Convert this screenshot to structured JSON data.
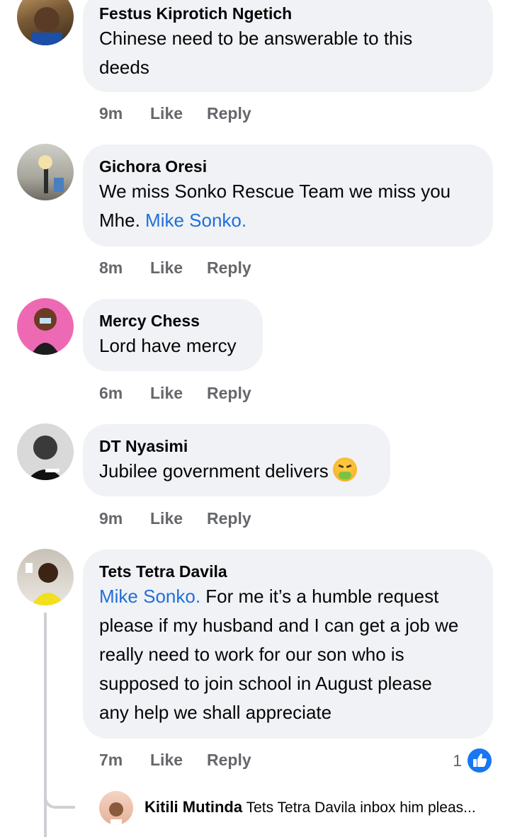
{
  "comments": [
    {
      "name": "Festus Kiprotich Ngetich",
      "text_lines": [
        "Chinese need to be answerable to this",
        "deeds"
      ],
      "time": "9m",
      "like": "Like",
      "reply": "Reply"
    },
    {
      "name": "Gichora Oresi",
      "line1": "We miss Sonko Rescue Team we miss you",
      "line2_prefix": "Mhe. ",
      "mention": "Mike Sonko.",
      "time": "8m",
      "like": "Like",
      "reply": "Reply"
    },
    {
      "name": "Mercy Chess",
      "text": "Lord have mercy",
      "time": "6m",
      "like": "Like",
      "reply": "Reply"
    },
    {
      "name": "DT Nyasimi",
      "text": "Jubilee government delivers",
      "emoji": "nauseated-face",
      "time": "9m",
      "like": "Like",
      "reply": "Reply"
    },
    {
      "name": "Tets Tetra Davila",
      "mention": "Mike Sonko.",
      "line1_rest": " For me it’s a humble request",
      "lines": [
        "please if my husband and I can get a job we",
        "really need to work for our son who is",
        "supposed to join school in August please",
        "any help we shall appreciate"
      ],
      "time": "7m",
      "like": "Like",
      "reply": "Reply",
      "like_count": "1"
    }
  ],
  "reply_preview": {
    "name": "Kitili Mutinda",
    "text": "Tets Tetra Davila inbox him pleas..."
  },
  "colors": {
    "bubble": "#f0f2f5",
    "mention": "#216fdb",
    "meta": "#65676b",
    "like_blue": "#1877f2"
  }
}
